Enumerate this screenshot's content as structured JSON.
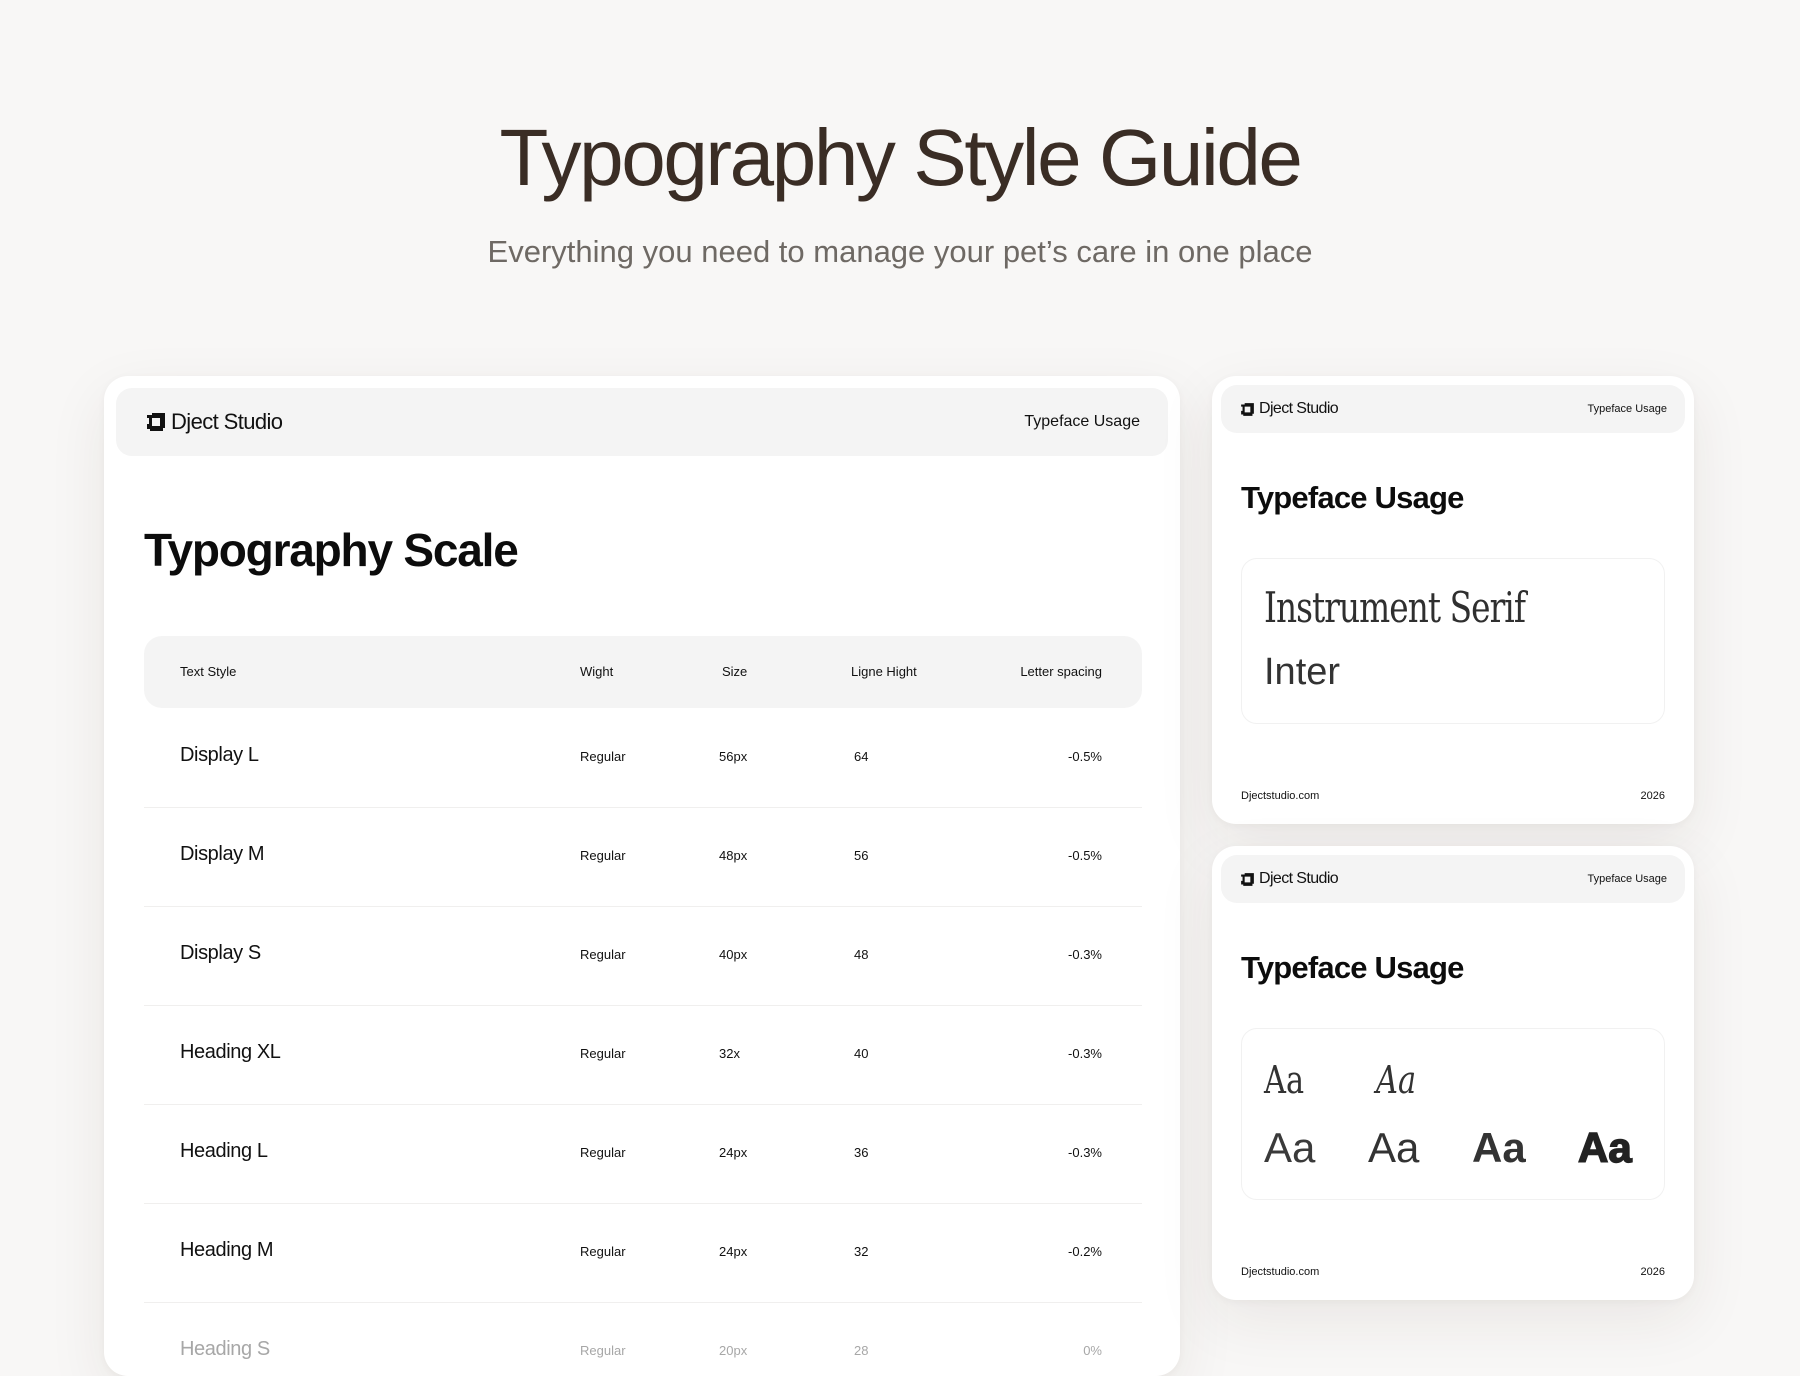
{
  "hero": {
    "title": "Typography Style Guide",
    "subtitle": "Everything you need to manage your pet’s care in one place"
  },
  "brand": {
    "name": "Dject Studio",
    "logo_icon": "dject-logo-icon"
  },
  "main_card": {
    "header_link": "Typeface Usage",
    "section_title": "Typography Scale",
    "columns": [
      "Text Style",
      "Wight",
      "Size",
      "Ligne Hight",
      "Letter spacing"
    ],
    "rows": [
      {
        "style": "Display L",
        "weight": "Regular",
        "size": "56px",
        "line_height": "64",
        "letter_spacing": "-0.5%"
      },
      {
        "style": "Display M",
        "weight": "Regular",
        "size": "48px",
        "line_height": "56",
        "letter_spacing": "-0.5%"
      },
      {
        "style": "Display S",
        "weight": "Regular",
        "size": "40px",
        "line_height": "48",
        "letter_spacing": "-0.3%"
      },
      {
        "style": "Heading XL",
        "weight": "Regular",
        "size": "32x",
        "line_height": "40",
        "letter_spacing": "-0.3%"
      },
      {
        "style": "Heading L",
        "weight": "Regular",
        "size": "24px",
        "line_height": "36",
        "letter_spacing": "-0.3%"
      },
      {
        "style": "Heading M",
        "weight": "Regular",
        "size": "24px",
        "line_height": "32",
        "letter_spacing": "-0.2%"
      },
      {
        "style": "Heading S",
        "weight": "Regular",
        "size": "20px",
        "line_height": "28",
        "letter_spacing": "0%"
      }
    ]
  },
  "side_card_1": {
    "header_link": "Typeface Usage",
    "section_title": "Typeface Usage",
    "fonts": [
      "Instrument Serif",
      "Inter"
    ],
    "footer_site": "Djectstudio.com",
    "footer_year": "2026"
  },
  "side_card_2": {
    "header_link": "Typeface Usage",
    "section_title": "Typeface Usage",
    "sample": "Aa",
    "footer_site": "Djectstudio.com",
    "footer_year": "2026"
  }
}
